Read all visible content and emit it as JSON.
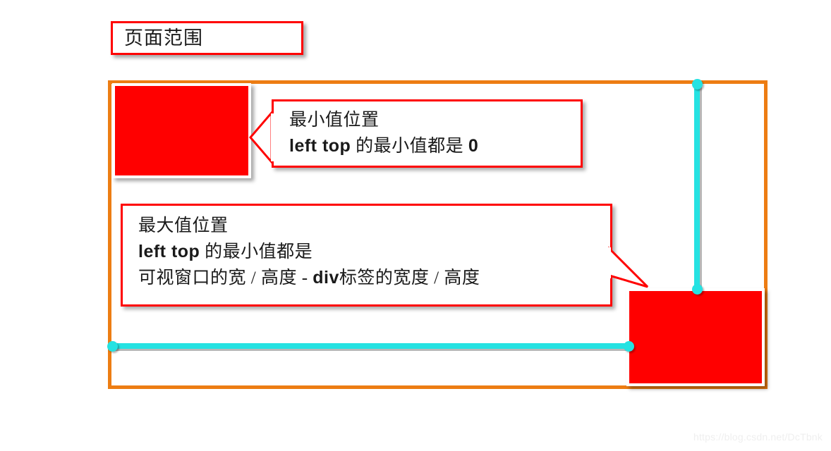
{
  "diagram": {
    "title_box": {
      "label": "页面范围",
      "border_color": "#ff0000"
    },
    "page_frame": {
      "name": "page-range-frame",
      "border_color": "#ed7d13"
    },
    "boxes": [
      {
        "name": "div-min-position",
        "color": "#ff0000",
        "border_color": "#ffffff"
      },
      {
        "name": "div-max-position",
        "color": "#ff0000",
        "border_color": "#ffffff"
      }
    ],
    "measure_lines": {
      "color": "#25e2e2",
      "vertical_label": "",
      "horizontal_label": ""
    },
    "callouts": [
      {
        "name": "min-value-callout",
        "border_color": "#ff0000",
        "lines": [
          {
            "text": "最小值位置"
          },
          {
            "latin_a": "left  top",
            "cjk": " 的最小值都是 ",
            "latin_b": "0"
          }
        ]
      },
      {
        "name": "max-value-callout",
        "border_color": "#ff0000",
        "lines": [
          {
            "text": "最大值位置"
          },
          {
            "latin_a": "left  top",
            "cjk": " 的最小值都是",
            "latin_b": ""
          },
          {
            "prefix": "可视窗口的宽 / 高度 - ",
            "latin_a": "div",
            "suffix": "标签的宽度 / 高度"
          }
        ]
      }
    ],
    "watermark": "https://blog.csdn.net/DcTbnk"
  }
}
